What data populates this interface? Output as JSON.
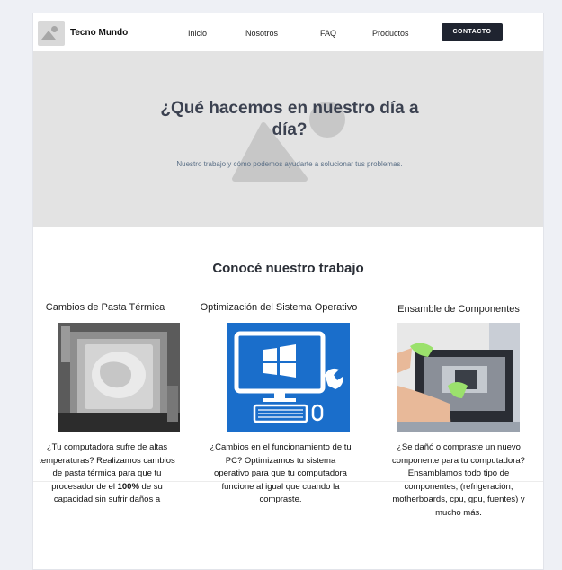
{
  "header": {
    "brand": "Tecno Mundo",
    "nav": [
      "Inicio",
      "Nosotros",
      "FAQ",
      "Productos"
    ],
    "contact_label": "CONTACTO"
  },
  "hero": {
    "title": "¿Qué hacemos en nuestro día a día?",
    "subtitle": "Nuestro trabajo y cómo podemos ayudarte a solucionar tus problemas."
  },
  "section": {
    "title": "Conocé nuestro trabajo",
    "cards": [
      {
        "title": "Cambios de Pasta Térmica",
        "text_a": "¿Tu computadora sufre de altas temperaturas? Realizamos cambios de pasta térmica para que tu procesador de el ",
        "text_b": "100%",
        "text_c": " de su capacidad sin sufrir daños a"
      },
      {
        "title": "Optimización del Sistema Operativo",
        "text": "¿Cambios en el funcionamiento de tu PC? Optimizamos tu sistema operativo para que tu computadora funcione al igual que cuando la compraste."
      },
      {
        "title": "Ensamble de Componentes",
        "text": "¿Se dañó o compraste un nuevo componente para tu computadora? Ensamblamos todo tipo de componentes, (refrigeración, motherboards, cpu, gpu, fuentes) y mucho más."
      }
    ]
  },
  "colors": {
    "contact_bg": "#1f2430",
    "hero_bg": "#e3e3e3",
    "windows_blue": "#1565c0"
  }
}
